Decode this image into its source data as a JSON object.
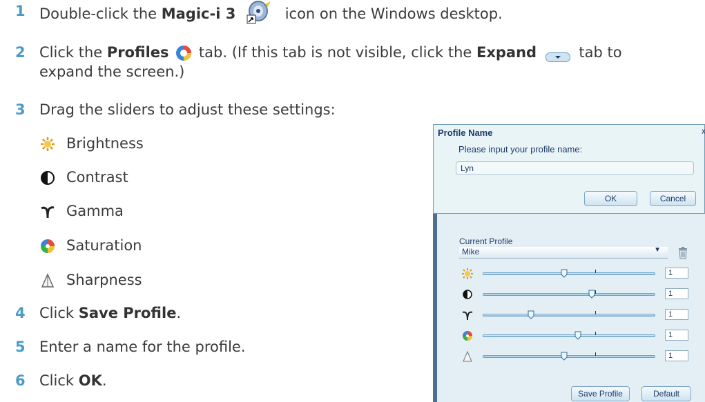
{
  "steps": [
    {
      "num": "1",
      "pre": "Double-click the ",
      "bold": "Magic-i 3",
      "post": " icon on the Windows desktop."
    },
    {
      "num": "2",
      "pre": "Click the ",
      "bold": "Profiles",
      "mid": " tab. (If this tab is not visible, click the ",
      "bold2": "Expand",
      "post": " tab to",
      "line2": "expand the screen.)"
    },
    {
      "num": "3",
      "text": "Drag the sliders to adjust these settings:"
    },
    {
      "num": "4",
      "pre": "Click ",
      "bold": "Save Profile",
      "post": "."
    },
    {
      "num": "5",
      "text": "Enter a name for the profile."
    },
    {
      "num": "6",
      "pre": "Click ",
      "bold": "OK",
      "post": "."
    }
  ],
  "settings": [
    {
      "label": "Brightness",
      "icon": "brightness-icon"
    },
    {
      "label": "Contrast",
      "icon": "contrast-icon"
    },
    {
      "label": "Gamma",
      "icon": "gamma-icon"
    },
    {
      "label": "Saturation",
      "icon": "saturation-icon"
    },
    {
      "label": "Sharpness",
      "icon": "sharpness-icon"
    }
  ],
  "dialog": {
    "title": "Profile Name",
    "close": "x",
    "prompt": "Please input your profile name:",
    "input_value": "Lyn",
    "ok_label": "OK",
    "cancel_label": "Cancel",
    "current_profile_label": "Current Profile",
    "current_profile_value": "Mike",
    "sliders": [
      {
        "name": "brightness",
        "level": 0.47,
        "value": "1"
      },
      {
        "name": "contrast",
        "level": 0.63,
        "value": "1"
      },
      {
        "name": "gamma",
        "level": 0.28,
        "value": "1"
      },
      {
        "name": "saturation",
        "level": 0.55,
        "value": "1"
      },
      {
        "name": "sharpness",
        "level": 0.47,
        "value": "1"
      }
    ],
    "save_profile_label": "Save Profile",
    "default_label": "Default"
  },
  "colors": {
    "step_number": "#4b9bc7",
    "dialog_text": "#1d3b69",
    "dialog_frame": "#4e6f8d"
  }
}
